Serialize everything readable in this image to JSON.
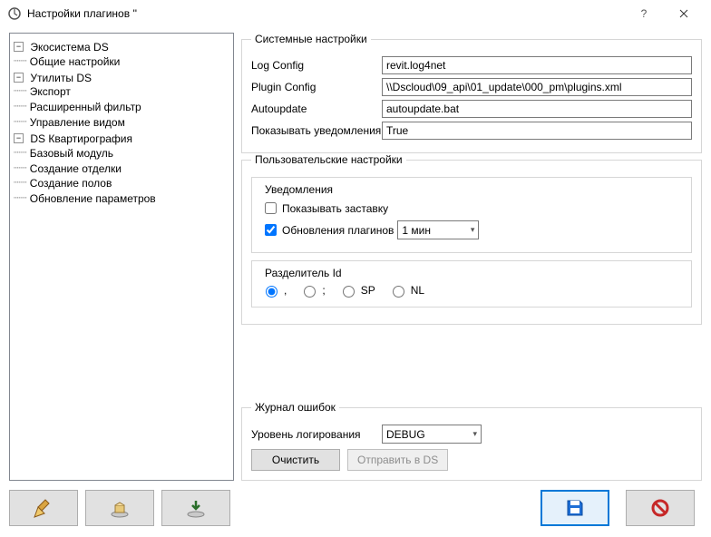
{
  "window": {
    "title": "Настройки плагинов ''"
  },
  "tree": {
    "eco": {
      "label": "Экосистема DS",
      "expanded": true,
      "children": [
        {
          "label": "Общие настройки"
        }
      ]
    },
    "util": {
      "label": "Утилиты DS",
      "expanded": true,
      "children": [
        {
          "label": "Экспорт"
        },
        {
          "label": "Расширенный фильтр"
        },
        {
          "label": "Управление видом"
        }
      ]
    },
    "kvart": {
      "label": "DS Квартирография",
      "expanded": true,
      "children": [
        {
          "label": "Базовый модуль"
        },
        {
          "label": "Создание отделки"
        },
        {
          "label": "Создание полов"
        },
        {
          "label": "Обновление параметров"
        }
      ]
    }
  },
  "system": {
    "legend": "Системные настройки",
    "logconfig_label": "Log Config",
    "logconfig_value": "revit.log4net",
    "pluginconfig_label": "Plugin Config",
    "pluginconfig_value": "\\\\Dscloud\\09_api\\01_update\\000_pm\\plugins.xml",
    "autoupdate_label": "Autoupdate",
    "autoupdate_value": "autoupdate.bat",
    "notify_label": "Показывать уведомления",
    "notify_value": "True"
  },
  "user": {
    "legend": "Пользовательские настройки",
    "notifications": {
      "legend": "Уведомления",
      "show_splash": "Показывать заставку",
      "show_splash_checked": false,
      "plugin_updates": "Обновления плагинов",
      "plugin_updates_checked": true,
      "interval": "1 мин"
    },
    "separator": {
      "legend": "Разделитель Id",
      "options": [
        ",",
        ";",
        "SP",
        "NL"
      ],
      "selected": ","
    }
  },
  "errlog": {
    "legend": "Журнал ошибок",
    "level_label": "Уровень логирования",
    "level_value": "DEBUG",
    "clear_btn": "Очистить",
    "send_btn": "Отправить в DS"
  },
  "buttons": {
    "save": "save",
    "cancel": "cancel"
  }
}
